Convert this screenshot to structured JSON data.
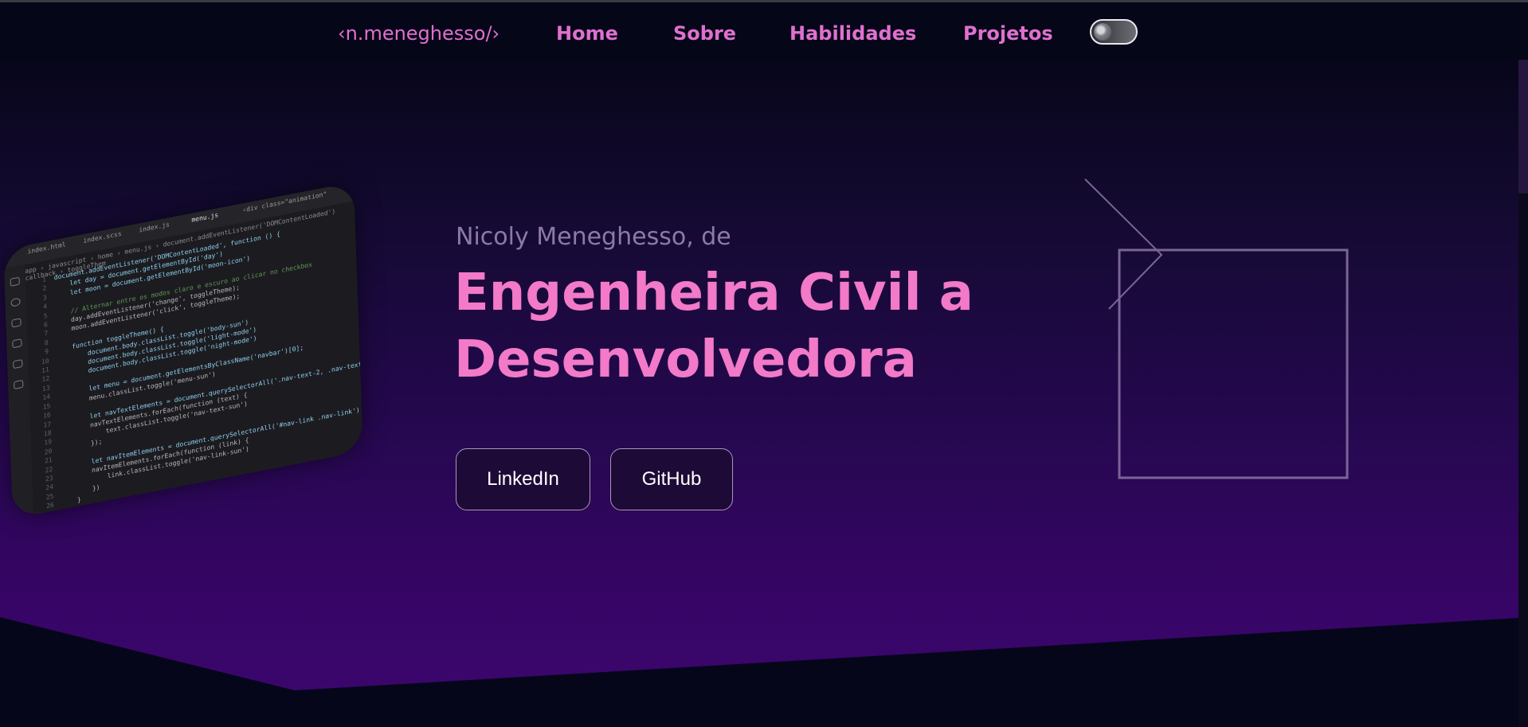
{
  "nav": {
    "logo": "‹n.meneghesso/›",
    "links": [
      "Home",
      "Sobre",
      "Habilidades",
      "Projetos"
    ],
    "theme_toggle_icon": "moon-icon"
  },
  "hero": {
    "subtitle": "Nicoly Meneghesso, de",
    "title_line1": "Engenheira Civil a",
    "title_line2": "Desenvolvedora",
    "buttons": {
      "linkedin": "LinkedIn",
      "github": "GitHub"
    }
  },
  "code_image": {
    "tabs": [
      "index.html",
      "index.scss",
      "index.js",
      "menu.js",
      "‹div class=\"animation\""
    ],
    "breadcrumb": "app › javascript › home › menu.js › document.addEventListener('DOMContentLoaded') callback › toggleThem",
    "lines": [
      "document.addEventListener('DOMContentLoaded', function () {",
      "    let day = document.getElementById('day')",
      "    let moon = document.getElementById('moon-icon')",
      "",
      "    // Alternar entre os modos claro e escuro ao clicar no checkbox",
      "    day.addEventListener('change', toggleTheme);",
      "    moon.addEventListener('click', toggleTheme);",
      "",
      "    function toggleTheme() {",
      "        document.body.classList.toggle('body-sun')",
      "        document.body.classList.toggle('light-mode')",
      "        document.body.classList.toggle('night-mode')",
      "",
      "        let menu = document.getElementsByClassName('navbar')[0];",
      "        menu.classList.toggle('menu-sun')",
      "",
      "        let navTextElements = document.querySelectorAll('.nav-text-2, .nav-text')",
      "        navTextElements.forEach(function (text) {",
      "            text.classList.toggle('nav-text-sun')",
      "        });",
      "",
      "        let navItemElements = document.querySelectorAll('#nav-link .nav-link')",
      "        navItemElements.forEach(function (link) {",
      "            link.classList.toggle('nav-link-sun')",
      "        })",
      "    }",
      "});",
      ""
    ]
  },
  "colors": {
    "accent_pink": "#f27ac8",
    "nav_link": "#e070d0",
    "subtitle": "#8c7aa6",
    "nav_bg": "#050617",
    "hero_bottom": "#3d0670"
  }
}
